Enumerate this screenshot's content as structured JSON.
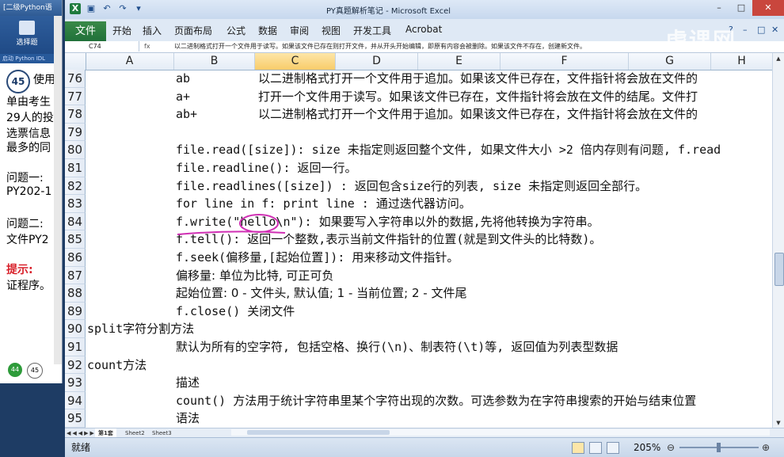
{
  "bgwindow": {
    "title": "[二级Python语",
    "select_label": "选择题",
    "subbar": "启动 Python IDL",
    "question_number": "45",
    "lines": [
      "使用",
      "单由考生",
      "29人的投",
      "选票信息",
      "最多的同",
      "",
      "问题一:",
      "PY202-1",
      "",
      "问题二:",
      "文件PY2",
      "",
      "提示:",
      "证程序。"
    ],
    "hint_word": "提示:",
    "pages": [
      "44",
      "45"
    ]
  },
  "excel": {
    "title": "PY真题解析笔记 - Microsoft Excel",
    "tabs": [
      "开始",
      "插入",
      "页面布局",
      "公式",
      "数据",
      "审阅",
      "视图",
      "开发工具",
      "Acrobat"
    ],
    "file_tab": "文件",
    "name_box": "C74",
    "fx_label": "fx",
    "formula_text": "以二进制格式打开一个文件用于读写。如果该文件已存在则打开文件，并从开头开始编辑，即原有内容会被删除。如果该文件不存在，创建新文件。",
    "columns": [
      "A",
      "B",
      "C",
      "D",
      "E",
      "F",
      "G",
      "H"
    ],
    "selected_column": "C",
    "rows": [
      {
        "n": "76",
        "a": "",
        "b": "ab",
        "c": "以二进制格式打开一个文件用于追加。如果该文件已存在，文件指针将会放在文件的"
      },
      {
        "n": "77",
        "a": "",
        "b": "a+",
        "c": "打开一个文件用于读写。如果该文件已存在，文件指针将会放在文件的结尾。文件打"
      },
      {
        "n": "78",
        "a": "",
        "b": "ab+",
        "c": "以二进制格式打开一个文件用于追加。如果该文件已存在，文件指针将会放在文件的"
      },
      {
        "n": "79",
        "a": "",
        "b": "",
        "c": ""
      },
      {
        "n": "80",
        "a": "",
        "b": "file.read([size]): size 未指定则返回整个文件, 如果文件大小 >2 倍内存则有问题, f.read",
        "c": ""
      },
      {
        "n": "81",
        "a": "",
        "b": "file.readline(): 返回一行。",
        "c": ""
      },
      {
        "n": "82",
        "a": "",
        "b": "file.readlines([size]) : 返回包含size行的列表, size 未指定则返回全部行。",
        "c": ""
      },
      {
        "n": "83",
        "a": "",
        "b": "for line in f: print line : 通过迭代器访问。",
        "c": ""
      },
      {
        "n": "84",
        "a": "",
        "b": "f.write(\"hello\\n\"): 如果要写入字符串以外的数据,先将他转换为字符串。",
        "c": ""
      },
      {
        "n": "85",
        "a": "",
        "b": "f.tell(): 返回一个整数,表示当前文件指针的位置(就是到文件头的比特数)。",
        "c": ""
      },
      {
        "n": "86",
        "a": "",
        "b": "f.seek(偏移量,[起始位置]): 用来移动文件指针。",
        "c": ""
      },
      {
        "n": "87",
        "a": "",
        "b": "偏移量: 单位为比特, 可正可负",
        "c": ""
      },
      {
        "n": "88",
        "a": "",
        "b": "起始位置: 0 - 文件头, 默认值; 1 - 当前位置; 2 - 文件尾",
        "c": ""
      },
      {
        "n": "89",
        "a": "",
        "b": "f.close()  关闭文件",
        "c": ""
      },
      {
        "n": "90",
        "a": "split字符分割方法",
        "b": "",
        "c": ""
      },
      {
        "n": "91",
        "a": "",
        "b": "默认为所有的空字符, 包括空格、换行(\\n)、制表符(\\t)等, 返回值为列表型数据",
        "c": ""
      },
      {
        "n": "92",
        "a": "count方法",
        "b": "",
        "c": ""
      },
      {
        "n": "93",
        "a": "",
        "b": "描述",
        "c": ""
      },
      {
        "n": "94",
        "a": "",
        "b": "count() 方法用于统计字符串里某个字符出现的次数。可选参数为在字符串搜索的开始与结束位置",
        "c": ""
      },
      {
        "n": "95",
        "a": "",
        "b": "语法",
        "c": ""
      }
    ],
    "sheets": [
      "第1套",
      "Sheet2",
      "Sheet3"
    ],
    "sheet_nav": "◀◀◀▶▶▶",
    "status_ready": "就绪",
    "zoom": "205%",
    "zoom_level": 0.47,
    "watermark": "虎课网"
  }
}
